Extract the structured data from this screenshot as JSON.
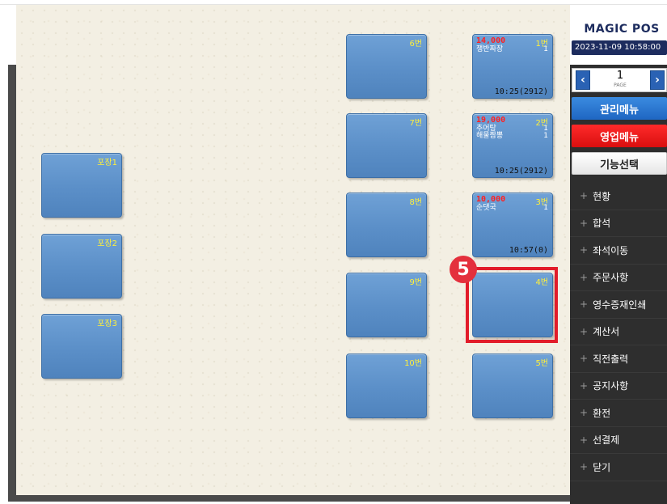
{
  "floor": {
    "tables": [
      {
        "id": "t6",
        "label": "6번",
        "amount": "",
        "items": [],
        "time": ""
      },
      {
        "id": "t1",
        "label": "1번",
        "amount": "14,000",
        "items": [
          {
            "name": "쟁반짜장",
            "qty": "1"
          }
        ],
        "time": "10:25(2912)"
      },
      {
        "id": "t7",
        "label": "7번",
        "amount": "",
        "items": [],
        "time": ""
      },
      {
        "id": "t2",
        "label": "2번",
        "amount": "19,000",
        "items": [
          {
            "name": "추어탕",
            "qty": "1"
          },
          {
            "name": "해물짬뽕",
            "qty": "1"
          }
        ],
        "time": "10:25(2912)"
      },
      {
        "id": "p1",
        "label": "포장1",
        "amount": "",
        "items": [],
        "time": ""
      },
      {
        "id": "t8",
        "label": "8번",
        "amount": "",
        "items": [],
        "time": ""
      },
      {
        "id": "t3",
        "label": "3번",
        "amount": "10,000",
        "items": [
          {
            "name": "순댓국",
            "qty": "1"
          }
        ],
        "time": "10:57(0)"
      },
      {
        "id": "p2",
        "label": "포장2",
        "amount": "",
        "items": [],
        "time": ""
      },
      {
        "id": "t9",
        "label": "9번",
        "amount": "",
        "items": [],
        "time": ""
      },
      {
        "id": "t4",
        "label": "4번",
        "amount": "",
        "items": [],
        "time": ""
      },
      {
        "id": "p3",
        "label": "포장3",
        "amount": "",
        "items": [],
        "time": ""
      },
      {
        "id": "t10",
        "label": "10번",
        "amount": "",
        "items": [],
        "time": ""
      },
      {
        "id": "t5",
        "label": "5번",
        "amount": "",
        "items": [],
        "time": ""
      }
    ]
  },
  "annotation": {
    "step_number": "5",
    "color": "#e21c2a"
  },
  "panel": {
    "brand": "MAGIC POS",
    "datetime": "2023-11-09 10:58:00",
    "pager": {
      "prev_icon": "chevron-left-icon",
      "page": "1",
      "caption": "PAGE",
      "next_icon": "chevron-right-icon"
    },
    "admin_menu": "관리메뉴",
    "sales_menu": "영업메뉴",
    "function_select": "기능선택",
    "menu_items": [
      {
        "label": "현황"
      },
      {
        "label": "합석"
      },
      {
        "label": "좌석이동"
      },
      {
        "label": "주문사항"
      },
      {
        "label": "영수증재인쇄"
      },
      {
        "label": "계산서"
      },
      {
        "label": "직전출력"
      },
      {
        "label": "공지사항"
      },
      {
        "label": "환전"
      },
      {
        "label": "선결제"
      },
      {
        "label": "닫기"
      }
    ],
    "colors": {
      "brand": "#1d2c5e",
      "admin": "#1f66c2",
      "sales": "#d90f0f",
      "table": "#5b8fc8"
    }
  }
}
